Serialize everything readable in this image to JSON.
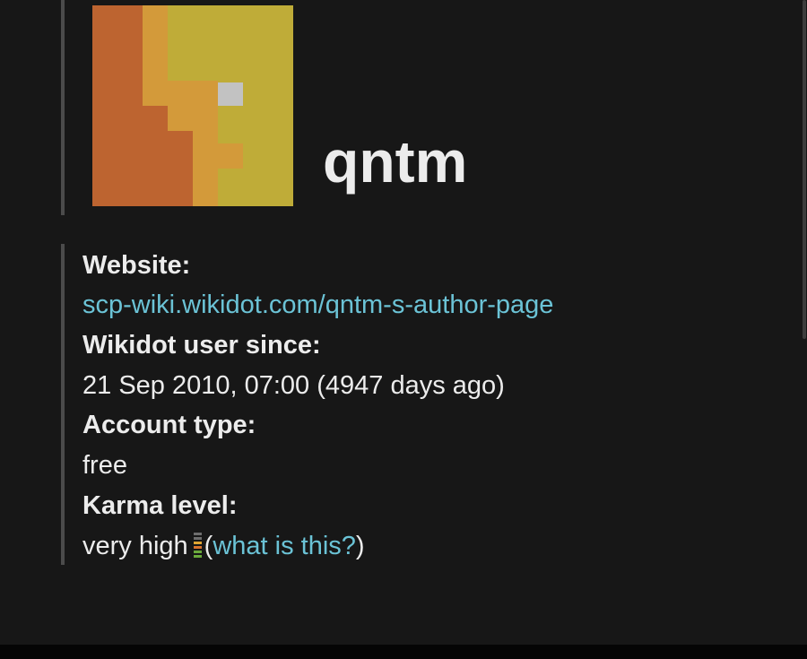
{
  "profile": {
    "username": "qntm",
    "avatar_icon": "pixel-avatar-icon",
    "avatar_colors": {
      "orange": "#bd6430",
      "mid": "#d39a3a",
      "yellow": "#bfac38",
      "dot": "#c2c2c2"
    }
  },
  "info": {
    "website_label": "Website:",
    "website_value": "scp-wiki.wikidot.com/qntm-s-author-page",
    "since_label": "Wikidot user since:",
    "since_value": "21 Sep 2010, 07:00 (4947 days ago)",
    "account_label": "Account type:",
    "account_value": "free",
    "karma_label": "Karma level:",
    "karma_value": "very high",
    "karma_icon": "karma-meter-icon",
    "karma_paren_open": "(",
    "karma_help_link": "what is this?",
    "karma_paren_close": ")"
  },
  "colors": {
    "background": "#171717",
    "link": "#6bc3d6",
    "text": "#ececec",
    "border": "#4b4b4b"
  }
}
